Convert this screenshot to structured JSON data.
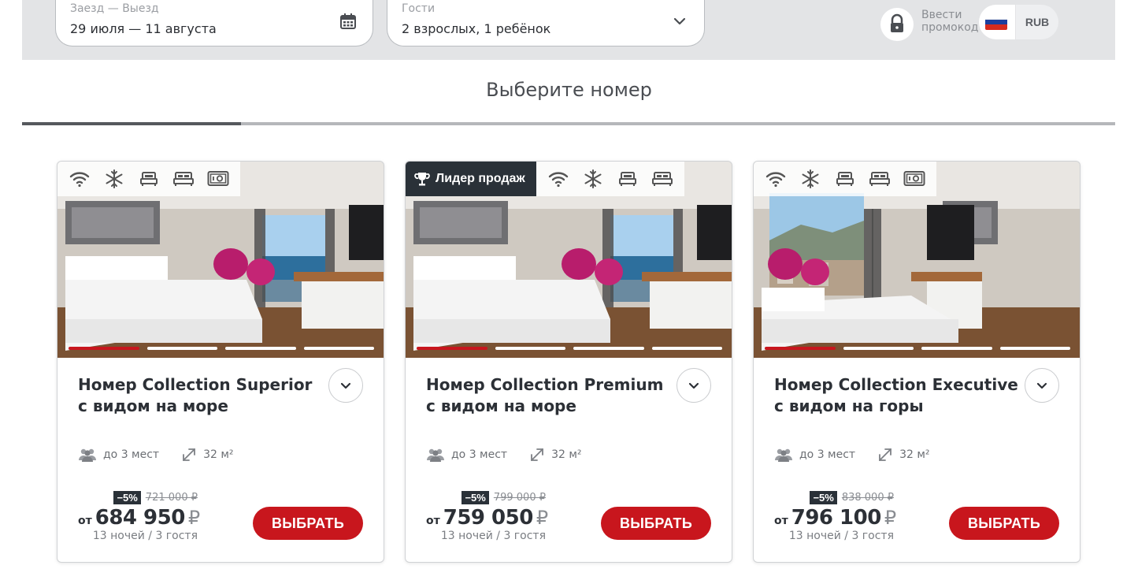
{
  "search": {
    "dates_label": "Заезд — Выезд",
    "dates_value": "29 июля — 11 августа",
    "guests_label": "Гости",
    "guests_value": "2 взрослых, 1 ребёнок",
    "promo_label": "Ввести промокод",
    "currency": "RUB",
    "language_flag": "russia-flag-icon"
  },
  "page": {
    "title": "Выберите номер",
    "step_progress": 0.2
  },
  "colors": {
    "accent": "#c8161d",
    "dark": "#2a3138",
    "topbar": "#e3e4e6"
  },
  "rooms": [
    {
      "title": "Номер Collection Superior с видом на море",
      "badge": "",
      "capacity": "до 3 мест",
      "area": "32 м²",
      "discount": "−5%",
      "old_price": "721 000 ₽",
      "price_from": "от",
      "price": "684 950",
      "currency_sign": "₽",
      "nights": "13 ночей / 3 гостя",
      "select_label": "ВЫБРАТЬ",
      "photo_count": 4,
      "active_photo": 1,
      "amenities": [
        "wifi-icon",
        "air-conditioning-icon",
        "bed-icon",
        "double-bed-icon",
        "safe-icon"
      ]
    },
    {
      "title": "Номер Collection Premium с видом на море",
      "badge": "Лидер продаж",
      "capacity": "до 3 мест",
      "area": "32 м²",
      "discount": "−5%",
      "old_price": "799 000 ₽",
      "price_from": "от",
      "price": "759 050",
      "currency_sign": "₽",
      "nights": "13 ночей / 3 гостя",
      "select_label": "ВЫБРАТЬ",
      "photo_count": 4,
      "active_photo": 1,
      "amenities": [
        "wifi-icon",
        "air-conditioning-icon",
        "bed-icon",
        "double-bed-icon"
      ]
    },
    {
      "title": "Номер Collection Executive с видом на горы",
      "badge": "",
      "capacity": "до 3 мест",
      "area": "32 м²",
      "discount": "−5%",
      "old_price": "838 000 ₽",
      "price_from": "от",
      "price": "796 100",
      "currency_sign": "₽",
      "nights": "13 ночей / 3 гостя",
      "select_label": "ВЫБРАТЬ",
      "photo_count": 4,
      "active_photo": 1,
      "amenities": [
        "wifi-icon",
        "air-conditioning-icon",
        "bed-icon",
        "double-bed-icon",
        "safe-icon"
      ]
    }
  ]
}
